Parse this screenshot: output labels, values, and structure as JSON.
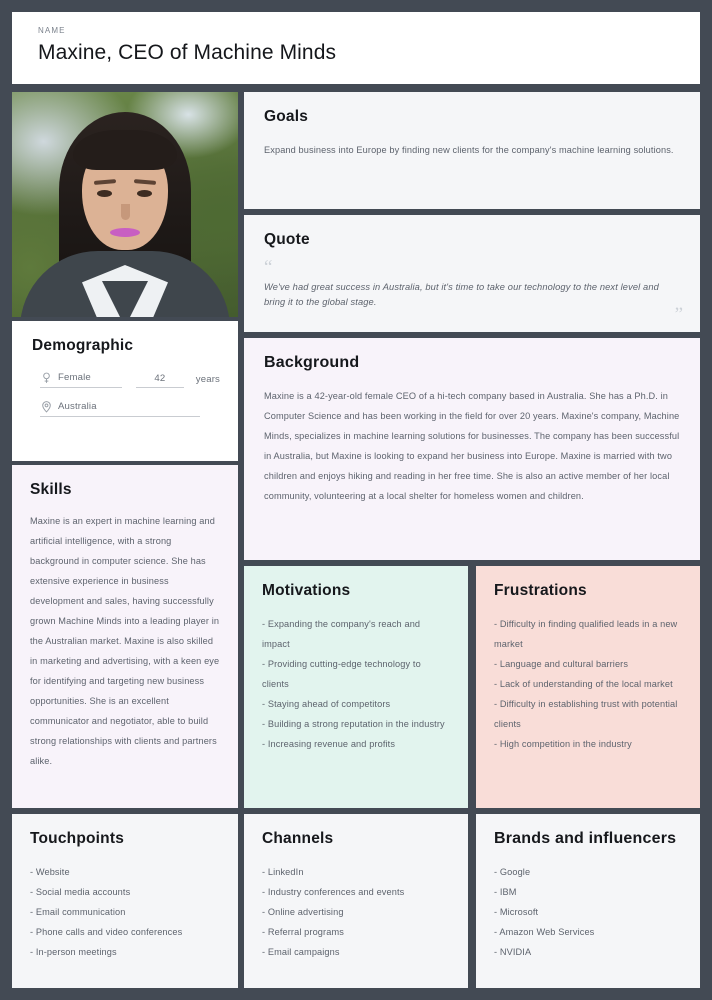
{
  "header": {
    "kicker": "NAME",
    "name": "Maxine, CEO of Machine Minds"
  },
  "photo": {
    "alt": "Portrait photo of Maxine"
  },
  "demographic": {
    "title": "Demographic",
    "gender": "Female",
    "gender_icon": "venus-icon",
    "age": "42",
    "age_unit": "years",
    "location": "Australia",
    "location_icon": "location-pin-icon"
  },
  "skills": {
    "title": "Skills",
    "text": "Maxine is an expert in machine learning and artificial intelligence, with a strong background in computer science. She has extensive experience in business development and sales, having successfully grown Machine Minds into a leading player in the Australian market. Maxine is also skilled in marketing and advertising, with a keen eye for identifying and targeting new business opportunities. She is an excellent communicator and negotiator, able to build strong relationships with clients and partners alike."
  },
  "goals": {
    "title": "Goals",
    "text": "Expand business into Europe by finding new clients for the company's machine learning solutions."
  },
  "quote": {
    "title": "Quote",
    "open_mark": "“",
    "close_mark": "”",
    "text": "We've had great success in Australia, but it's time to take our technology to the next level and bring it to the global stage."
  },
  "background": {
    "title": "Background",
    "text": "Maxine is a 42-year-old female CEO of a hi-tech company based in Australia. She has a Ph.D. in Computer Science and has been working in the field for over 20 years. Maxine's company, Machine Minds, specializes in machine learning solutions for businesses. The company has been successful in Australia, but Maxine is looking to expand her business into Europe. Maxine is married with two children and enjoys hiking and reading in her free time. She is also an active member of her local community, volunteering at a local shelter for homeless women and children."
  },
  "motivations": {
    "title": "Motivations",
    "items": [
      "- Expanding the company's reach and impact",
      "- Providing cutting-edge technology to clients",
      "- Staying ahead of competitors",
      "- Building a strong reputation in the industry",
      "- Increasing revenue and profits"
    ]
  },
  "frustrations": {
    "title": "Frustrations",
    "items": [
      "- Difficulty in finding qualified leads in a new market",
      "- Language and cultural barriers",
      "- Lack of understanding of the local market",
      "- Difficulty in establishing trust with potential clients",
      "- High competition in the industry"
    ]
  },
  "touchpoints": {
    "title": "Touchpoints",
    "items": [
      "- Website",
      "- Social media accounts",
      "- Email communication",
      "- Phone calls and video conferences",
      "- In-person meetings"
    ]
  },
  "channels": {
    "title": "Channels",
    "items": [
      "- LinkedIn",
      "- Industry conferences and events",
      "- Online advertising",
      "- Referral programs",
      "- Email campaigns"
    ]
  },
  "brands": {
    "title": "Brands and influencers",
    "items": [
      "- Google",
      "- IBM",
      "- Microsoft",
      "- Amazon Web Services",
      "- NVIDIA"
    ]
  },
  "colors": {
    "frame": "#434a54",
    "card": "#f5f6f8",
    "white_card": "#ffffff",
    "lavender": "#f8f3fa",
    "mint": "#e2f4ee",
    "salmon": "#f9ddd8",
    "heading": "#16181c",
    "body": "#5d636d"
  }
}
